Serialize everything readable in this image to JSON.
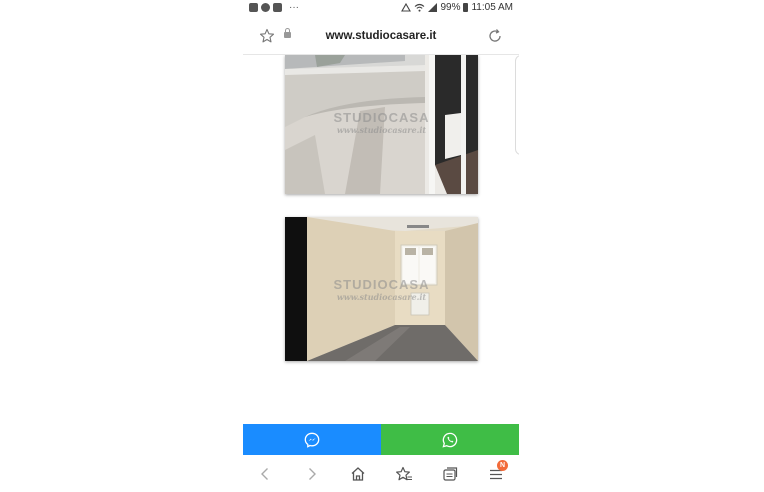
{
  "status_bar": {
    "dots": "···",
    "battery": "99%",
    "time": "11:05 AM"
  },
  "browser": {
    "url": "www.studiocasare.it"
  },
  "gallery": {
    "watermark_main": "STUDIOCASA",
    "watermark_sub": "www.studiocasare.it"
  },
  "share_bar": {
    "messenger_icon": "messenger-icon",
    "whatsapp_icon": "whatsapp-icon",
    "messenger_color": "#1a8cff",
    "whatsapp_color": "#3fbd46"
  },
  "nav": {
    "tabs_badge": "N"
  }
}
